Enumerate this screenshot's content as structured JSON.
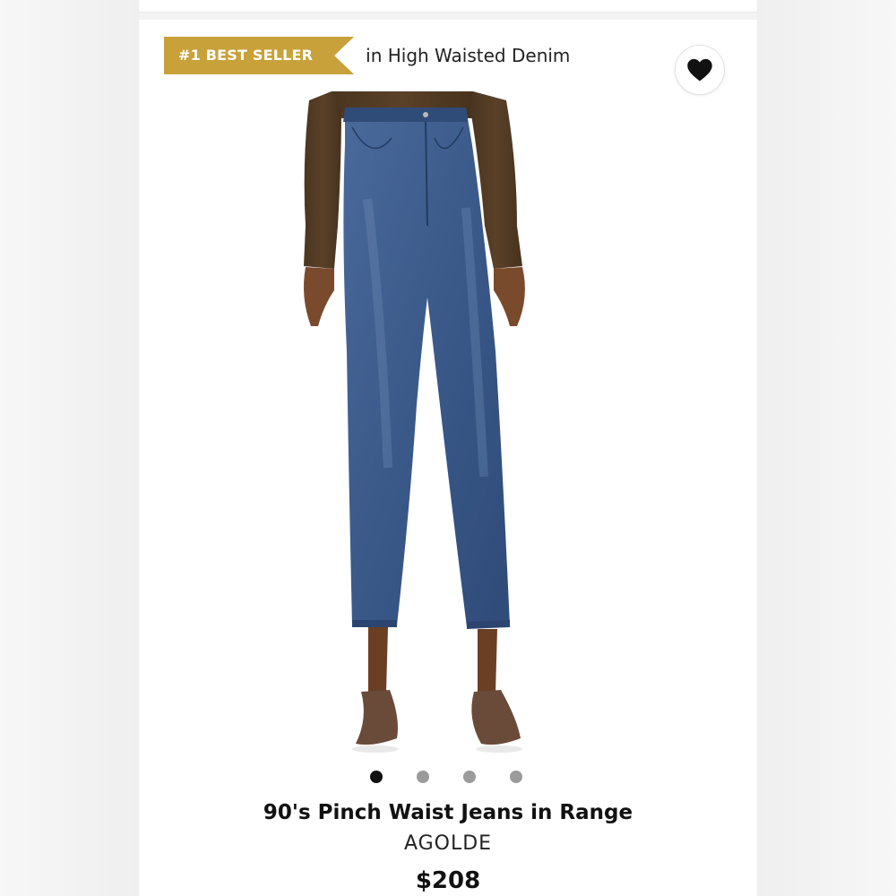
{
  "badge": {
    "label": "#1 BEST SELLER",
    "context": "in High Waisted Denim",
    "color": "#c8a13a"
  },
  "wishlist": {
    "icon": "heart-icon",
    "active": true
  },
  "product_image": {
    "icon": "product-photo"
  },
  "carousel": {
    "total": 4,
    "active_index": 0
  },
  "product": {
    "title": "90's Pinch Waist Jeans in Range",
    "brand": "AGOLDE",
    "price": "$208"
  }
}
